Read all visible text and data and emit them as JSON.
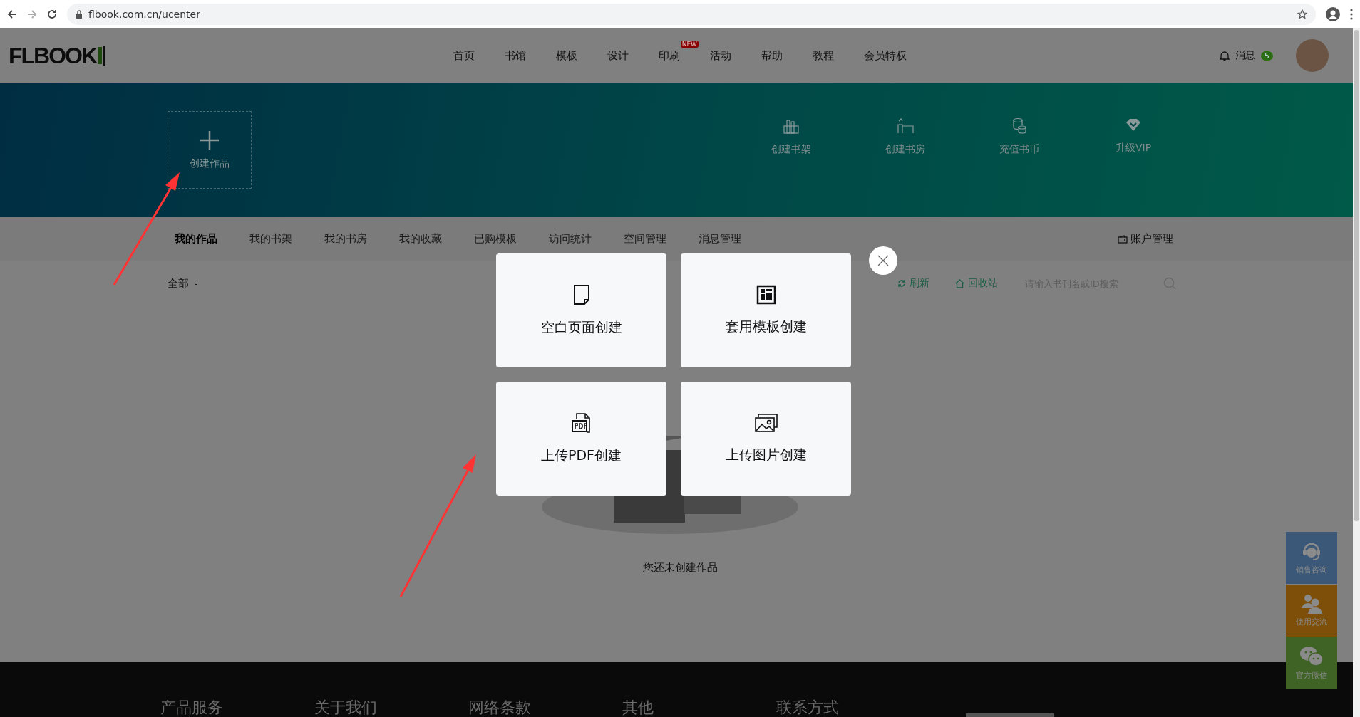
{
  "browser": {
    "url": "flbook.com.cn/ucenter"
  },
  "header": {
    "logo": "FLBOOK",
    "nav": [
      {
        "label": "首页"
      },
      {
        "label": "书馆"
      },
      {
        "label": "模板"
      },
      {
        "label": "设计"
      },
      {
        "label": "印刷",
        "badge": "NEW"
      },
      {
        "label": "活动"
      },
      {
        "label": "帮助"
      },
      {
        "label": "教程"
      },
      {
        "label": "会员特权"
      }
    ],
    "messages": {
      "label": "消息",
      "count": "5"
    }
  },
  "banner": {
    "create": {
      "label": "创建作品"
    },
    "actions": [
      {
        "kind": "shelf",
        "label": "创建书架"
      },
      {
        "kind": "study",
        "label": "创建书房"
      },
      {
        "kind": "coins",
        "label": "充值书币"
      },
      {
        "kind": "vip",
        "label": "升级VIP"
      }
    ]
  },
  "tabs": [
    {
      "label": "我的作品",
      "selected": true
    },
    {
      "label": "我的书架",
      "selected": false
    },
    {
      "label": "我的书房",
      "selected": false
    },
    {
      "label": "我的收藏",
      "selected": false
    },
    {
      "label": "已购模板",
      "selected": false
    },
    {
      "label": "访问统计",
      "selected": false
    },
    {
      "label": "空间管理",
      "selected": false
    },
    {
      "label": "消息管理",
      "selected": false
    }
  ],
  "account": "账户管理",
  "toolbar": {
    "filter": "全部",
    "refresh": "刷新",
    "recycle": "回收站",
    "search": {
      "placeholder": "请输入书刊名或ID搜索"
    }
  },
  "empty": {
    "message": "您还未创建作品"
  },
  "modal": {
    "options": [
      {
        "kind": "blank",
        "label": "空白页面创建"
      },
      {
        "kind": "template",
        "label": "套用模板创建"
      },
      {
        "kind": "pdf",
        "label": "上传PDF创建"
      },
      {
        "kind": "image",
        "label": "上传图片创建"
      }
    ]
  },
  "side_widgets": [
    {
      "kind": "headset",
      "label": "销售咨询",
      "color": "#3b5878"
    },
    {
      "kind": "people",
      "label": "使用交流",
      "color": "#7d4f08"
    },
    {
      "kind": "chat",
      "label": "官方微信",
      "color": "#3f6325"
    }
  ],
  "footer": {
    "columns": [
      "产品服务",
      "关于我们",
      "网络条款",
      "其他",
      "联系方式"
    ]
  }
}
